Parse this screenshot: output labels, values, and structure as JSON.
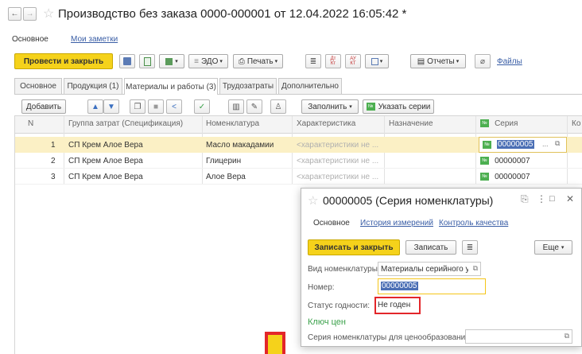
{
  "window": {
    "title": "Производство без заказа 0000-000001 от 12.04.2022 16:05:42 *"
  },
  "nav": {
    "main": "Основное",
    "notes": "Мои заметки"
  },
  "toolbar": {
    "post_close": "Провести и закрыть",
    "edo": "ЭДО",
    "print": "Печать",
    "reports": "Отчеты",
    "files": "Файлы"
  },
  "tabs": [
    {
      "label": "Основное"
    },
    {
      "label": "Продукция (1)"
    },
    {
      "label": "Материалы и работы (3)"
    },
    {
      "label": "Трудозатраты"
    },
    {
      "label": "Дополнительно"
    }
  ],
  "table_toolbar": {
    "add": "Добавить",
    "fill": "Заполнить",
    "specify_series": "Указать серии"
  },
  "table": {
    "columns": [
      "N",
      "Группа затрат (Спецификация)",
      "Номенклатура",
      "Характеристика",
      "Назначение",
      "Серия",
      "Ко"
    ],
    "rows": [
      {
        "n": "1",
        "group": "СП Крем Алое Вера",
        "item": "Масло макадамии",
        "char": "<характеристики не ...",
        "purpose": "",
        "series": "00000005"
      },
      {
        "n": "2",
        "group": "СП Крем Алое Вера",
        "item": "Глицерин",
        "char": "<характеристики не ...",
        "purpose": "",
        "series": "00000007"
      },
      {
        "n": "3",
        "group": "СП Крем Алое Вера",
        "item": "Алое Вера",
        "char": "<характеристики не ...",
        "purpose": "",
        "series": "00000007"
      }
    ]
  },
  "popup": {
    "title": "00000005 (Серия номенклатуры)",
    "tab_main": "Основное",
    "tab_history": "История измерений",
    "tab_quality": "Контроль качества",
    "save_close": "Записать и закрыть",
    "save": "Записать",
    "more": "Еще",
    "kind_label": "Вид номенклатуры:",
    "kind_value": "Материалы серийного учё",
    "number_label": "Номер:",
    "number_value": "00000005",
    "status_label": "Статус годности:",
    "status_value": "Не годен",
    "price_key": "Ключ цен",
    "pricing_label": "Серия номенклатуры для ценообразования:",
    "pricing_value": ""
  },
  "colors": {
    "accent_yellow": "#f5d21b",
    "highlight_row": "#fbf0c5",
    "selection_blue": "#4b6fb5",
    "annotation_red": "#e3262a",
    "green_link": "#3aa14a"
  }
}
